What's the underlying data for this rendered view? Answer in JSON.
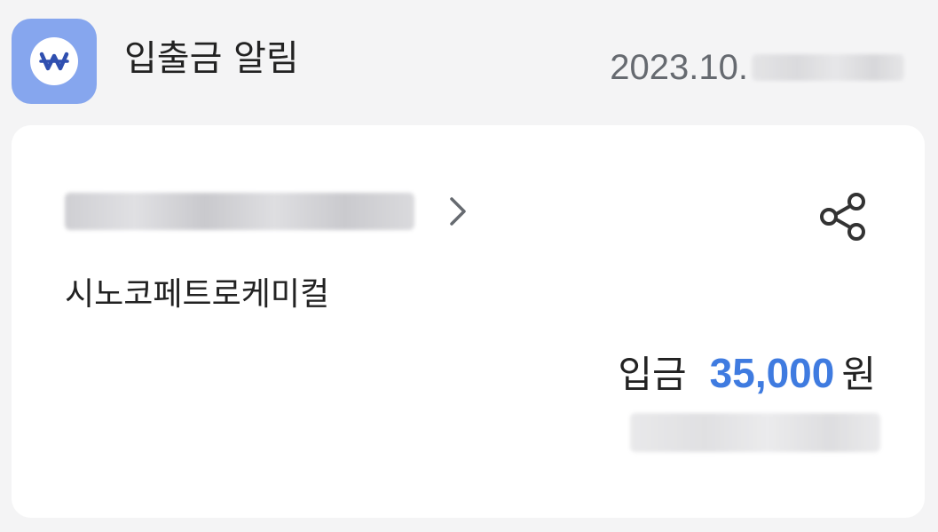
{
  "notification": {
    "app_title": "입출금 알림",
    "app_icon": "won-sign-icon",
    "timestamp": "2023.10."
  },
  "card": {
    "merchant_name": "시노코페트로케미컬",
    "transaction_type": "입금",
    "amount": "35,000",
    "currency_unit": "원",
    "icons": {
      "chevron": "chevron-right-icon",
      "share": "share-icon"
    }
  },
  "colors": {
    "background": "#f4f4f5",
    "card_background": "#ffffff",
    "app_icon_background": "#86a6ee",
    "accent": "#3f7be0",
    "secondary_text": "#666a70"
  }
}
